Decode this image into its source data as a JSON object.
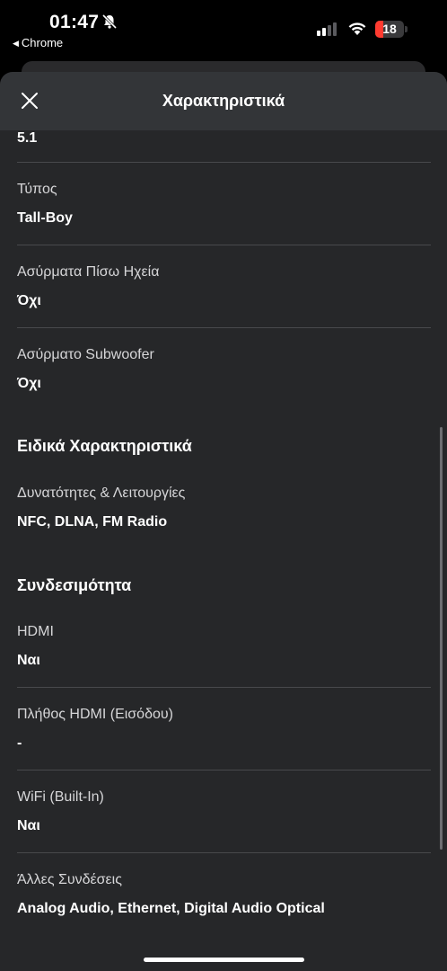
{
  "status_bar": {
    "time": "01:47",
    "back_app": "Chrome",
    "battery_level": "18",
    "signal_bars": 2
  },
  "sheet": {
    "title": "Χαρακτηριστικά",
    "partial_value": "5.1",
    "rows_group1": [
      {
        "label": "Τύπος",
        "value": "Tall-Boy"
      },
      {
        "label": "Ασύρματα Πίσω Ηχεία",
        "value": "Όχι"
      },
      {
        "label": "Ασύρματο Subwoofer",
        "value": "Όχι"
      }
    ],
    "section_special": "Ειδικά Χαρακτηριστικά",
    "row_special": {
      "label": "Δυνατότητες & Λειτουργίες",
      "value": "NFC, DLNA, FM Radio"
    },
    "section_connectivity": "Συνδεσιμότητα",
    "rows_connectivity": [
      {
        "label": "HDMI",
        "value": "Ναι"
      },
      {
        "label": "Πλήθος HDMI (Εισόδου)",
        "value": "-"
      },
      {
        "label": "WiFi (Built-In)",
        "value": "Ναι"
      },
      {
        "label": "Άλλες Συνδέσεις",
        "value": "Analog Audio, Ethernet, Digital Audio Optical"
      }
    ]
  },
  "colors": {
    "sheet_bg": "#262729",
    "header_bg": "#333538",
    "divider": "#48494c",
    "battery_low": "#ff3b30"
  },
  "icons": {
    "close": "close-icon",
    "bell_off": "bell-slash-icon",
    "wifi": "wifi-icon",
    "signal": "cellular-signal-icon",
    "battery": "battery-icon"
  }
}
